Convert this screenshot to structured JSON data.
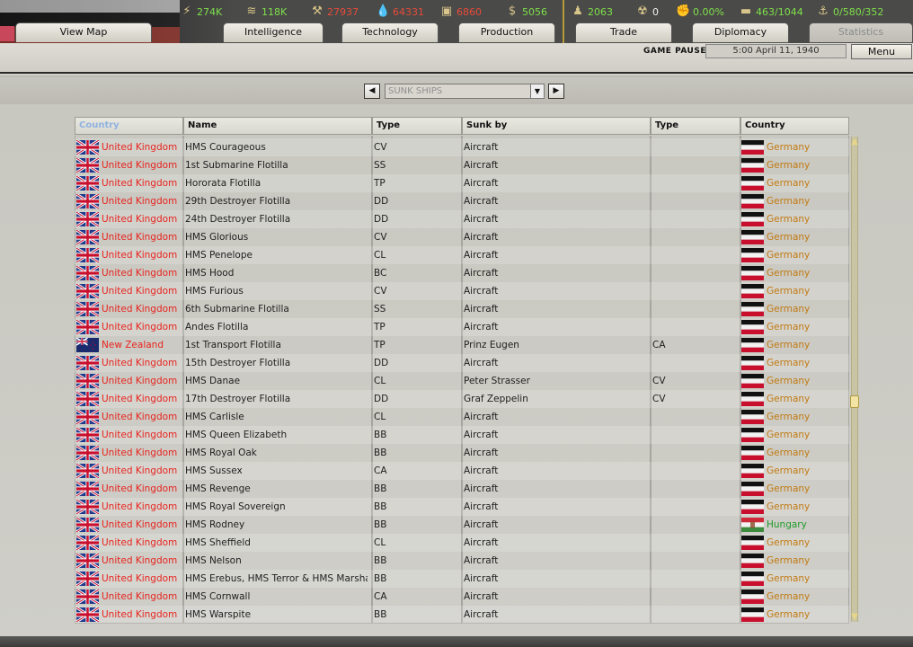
{
  "resources": [
    {
      "icon": "lightning-icon",
      "glyph": "⚡",
      "value": "274K",
      "color": "green"
    },
    {
      "icon": "metal-icon",
      "glyph": "≋",
      "value": "118K",
      "color": "green"
    },
    {
      "icon": "rare-materials-icon",
      "glyph": "⚒",
      "value": "27937",
      "color": "red"
    },
    {
      "icon": "oil-icon",
      "glyph": "💧",
      "value": "64331",
      "color": "red"
    },
    {
      "icon": "supplies-icon",
      "glyph": "▣",
      "value": "6860",
      "color": "red"
    },
    {
      "icon": "money-icon",
      "glyph": "$",
      "value": "5056",
      "color": "green"
    },
    {
      "icon": "manpower-icon",
      "glyph": "♟",
      "value": "2063",
      "color": "green"
    },
    {
      "icon": "nuclear-icon",
      "glyph": "☢",
      "value": "0",
      "color": "white"
    },
    {
      "icon": "dissent-icon",
      "glyph": "✊",
      "value": "0.00%",
      "color": "green"
    },
    {
      "icon": "transport-icon",
      "glyph": "▬",
      "value": "463/1044",
      "color": "green"
    },
    {
      "icon": "convoy-icon",
      "glyph": "⚓",
      "value": "0/580/352",
      "color": "green"
    }
  ],
  "tabs": [
    {
      "label": "View Map"
    },
    {
      "label": "Intelligence"
    },
    {
      "label": "Technology"
    },
    {
      "label": "Production"
    },
    {
      "label": "Trade"
    },
    {
      "label": "Diplomacy"
    },
    {
      "label": "Statistics"
    }
  ],
  "status": {
    "paused": "GAME PAUSED",
    "date": "5:00 April 11, 1940",
    "menu": "Menu"
  },
  "selector": {
    "value": "SUNK SHIPS",
    "prev": "◀",
    "next": "▶",
    "drop": "▼"
  },
  "table": {
    "headers": [
      "Country",
      "Name",
      "Type",
      "Sunk by",
      "Type",
      "Country"
    ],
    "rows": [
      {
        "country": "United Kingdom",
        "name": "HMS Courageous",
        "type": "CV",
        "sunk_by": "Aircraft",
        "sunk_type": "",
        "by_country": "Germany"
      },
      {
        "country": "United Kingdom",
        "name": "1st Submarine Flotilla",
        "type": "SS",
        "sunk_by": "Aircraft",
        "sunk_type": "",
        "by_country": "Germany"
      },
      {
        "country": "United Kingdom",
        "name": "Hororata Flotilla",
        "type": "TP",
        "sunk_by": "Aircraft",
        "sunk_type": "",
        "by_country": "Germany"
      },
      {
        "country": "United Kingdom",
        "name": "29th Destroyer Flotilla",
        "type": "DD",
        "sunk_by": "Aircraft",
        "sunk_type": "",
        "by_country": "Germany"
      },
      {
        "country": "United Kingdom",
        "name": "24th Destroyer Flotilla",
        "type": "DD",
        "sunk_by": "Aircraft",
        "sunk_type": "",
        "by_country": "Germany"
      },
      {
        "country": "United Kingdom",
        "name": "HMS Glorious",
        "type": "CV",
        "sunk_by": "Aircraft",
        "sunk_type": "",
        "by_country": "Germany"
      },
      {
        "country": "United Kingdom",
        "name": "HMS Penelope",
        "type": "CL",
        "sunk_by": "Aircraft",
        "sunk_type": "",
        "by_country": "Germany"
      },
      {
        "country": "United Kingdom",
        "name": "HMS Hood",
        "type": "BC",
        "sunk_by": "Aircraft",
        "sunk_type": "",
        "by_country": "Germany"
      },
      {
        "country": "United Kingdom",
        "name": "HMS Furious",
        "type": "CV",
        "sunk_by": "Aircraft",
        "sunk_type": "",
        "by_country": "Germany"
      },
      {
        "country": "United Kingdom",
        "name": "6th Submarine Flotilla",
        "type": "SS",
        "sunk_by": "Aircraft",
        "sunk_type": "",
        "by_country": "Germany"
      },
      {
        "country": "United Kingdom",
        "name": "Andes Flotilla",
        "type": "TP",
        "sunk_by": "Aircraft",
        "sunk_type": "",
        "by_country": "Germany"
      },
      {
        "country": "New Zealand",
        "name": "1st Transport Flotilla",
        "type": "TP",
        "sunk_by": "Prinz Eugen",
        "sunk_type": "CA",
        "by_country": "Germany"
      },
      {
        "country": "United Kingdom",
        "name": "15th Destroyer Flotilla",
        "type": "DD",
        "sunk_by": "Aircraft",
        "sunk_type": "",
        "by_country": "Germany"
      },
      {
        "country": "United Kingdom",
        "name": "HMS Danae",
        "type": "CL",
        "sunk_by": "Peter Strasser",
        "sunk_type": "CV",
        "by_country": "Germany"
      },
      {
        "country": "United Kingdom",
        "name": "17th Destroyer Flotilla",
        "type": "DD",
        "sunk_by": "Graf Zeppelin",
        "sunk_type": "CV",
        "by_country": "Germany"
      },
      {
        "country": "United Kingdom",
        "name": "HMS Carlisle",
        "type": "CL",
        "sunk_by": "Aircraft",
        "sunk_type": "",
        "by_country": "Germany"
      },
      {
        "country": "United Kingdom",
        "name": "HMS Queen Elizabeth",
        "type": "BB",
        "sunk_by": "Aircraft",
        "sunk_type": "",
        "by_country": "Germany"
      },
      {
        "country": "United Kingdom",
        "name": "HMS Royal Oak",
        "type": "BB",
        "sunk_by": "Aircraft",
        "sunk_type": "",
        "by_country": "Germany"
      },
      {
        "country": "United Kingdom",
        "name": "HMS Sussex",
        "type": "CA",
        "sunk_by": "Aircraft",
        "sunk_type": "",
        "by_country": "Germany"
      },
      {
        "country": "United Kingdom",
        "name": "HMS Revenge",
        "type": "BB",
        "sunk_by": "Aircraft",
        "sunk_type": "",
        "by_country": "Germany"
      },
      {
        "country": "United Kingdom",
        "name": "HMS Royal Sovereign",
        "type": "BB",
        "sunk_by": "Aircraft",
        "sunk_type": "",
        "by_country": "Germany"
      },
      {
        "country": "United Kingdom",
        "name": "HMS Rodney",
        "type": "BB",
        "sunk_by": "Aircraft",
        "sunk_type": "",
        "by_country": "Hungary"
      },
      {
        "country": "United Kingdom",
        "name": "HMS Sheffield",
        "type": "CL",
        "sunk_by": "Aircraft",
        "sunk_type": "",
        "by_country": "Germany"
      },
      {
        "country": "United Kingdom",
        "name": "HMS Nelson",
        "type": "BB",
        "sunk_by": "Aircraft",
        "sunk_type": "",
        "by_country": "Germany"
      },
      {
        "country": "United Kingdom",
        "name": "HMS Erebus, HMS Terror & HMS Marshal S",
        "type": "BB",
        "sunk_by": "Aircraft",
        "sunk_type": "",
        "by_country": "Germany"
      },
      {
        "country": "United Kingdom",
        "name": "HMS Cornwall",
        "type": "CA",
        "sunk_by": "Aircraft",
        "sunk_type": "",
        "by_country": "Germany"
      },
      {
        "country": "United Kingdom",
        "name": "HMS Warspite",
        "type": "BB",
        "sunk_by": "Aircraft",
        "sunk_type": "",
        "by_country": "Germany"
      }
    ]
  },
  "colors": {
    "uk_text": "#e8231e",
    "nz_text": "#e8231e",
    "germany_text": "#c27a12",
    "hungary_text": "#1f9a2a"
  }
}
